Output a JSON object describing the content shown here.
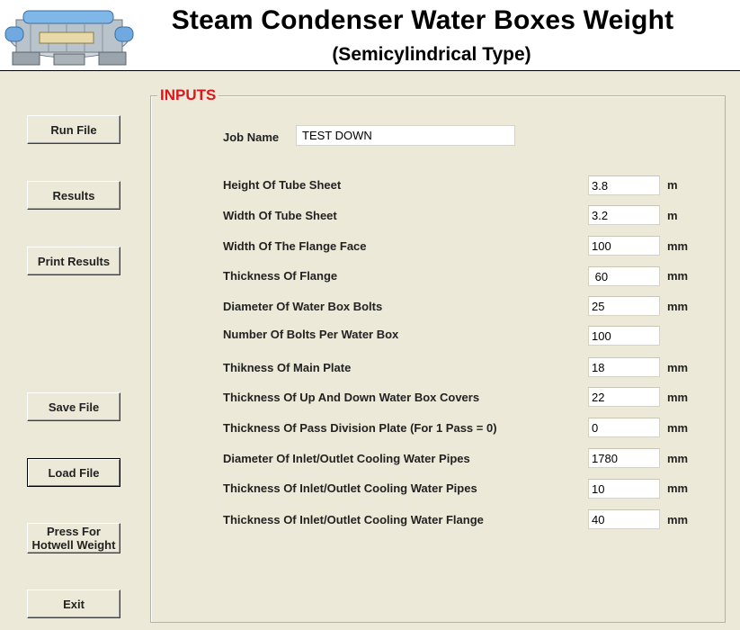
{
  "header": {
    "title": "Steam Condenser Water Boxes Weight",
    "subtitle": "(Semicylindrical Type)"
  },
  "buttons": {
    "run_file": "Run File",
    "results": "Results",
    "print_results": "Print Results",
    "save_file": "Save File",
    "load_file": "Load File",
    "hotwell_line1": "Press For",
    "hotwell_line2": "Hotwell Weight",
    "exit": "Exit"
  },
  "inputs": {
    "legend": "INPUTS",
    "job_name_label": "Job Name",
    "job_name_value": "TEST DOWN",
    "fields": [
      {
        "label": "Height Of Tube Sheet",
        "value": "3.8",
        "unit": "m"
      },
      {
        "label": "Width Of Tube Sheet",
        "value": "3.2",
        "unit": "m"
      },
      {
        "label": "Width Of The Flange Face",
        "value": "100",
        "unit": "mm"
      },
      {
        "label": "Thickness Of Flange",
        "value": " 60",
        "unit": "mm"
      },
      {
        "label": "Diameter Of Water Box Bolts",
        "value": "25",
        "unit": "mm"
      },
      {
        "label": "Number Of Bolts Per Water Box",
        "value": "100",
        "unit": ""
      },
      {
        "label": "Thikness Of Main Plate",
        "value": "18",
        "unit": "mm"
      },
      {
        "label": "Thickness Of Up And Down Water Box Covers",
        "value": "22",
        "unit": "mm"
      },
      {
        "label": "Thickness Of Pass Division Plate (For 1 Pass  =  0)",
        "value": "0",
        "unit": "mm"
      },
      {
        "label": "Diameter Of Inlet/Outlet Cooling Water Pipes",
        "value": "1780",
        "unit": "mm"
      },
      {
        "label": "Thickness Of Inlet/Outlet Cooling Water Pipes",
        "value": "10",
        "unit": "mm"
      },
      {
        "label": "Thickness Of Inlet/Outlet Cooling Water Flange",
        "value": "40",
        "unit": "mm"
      }
    ]
  },
  "colors": {
    "window_bg": "#ece9d8",
    "legend_red": "#e0141c",
    "header_bg": "#ffffff"
  }
}
